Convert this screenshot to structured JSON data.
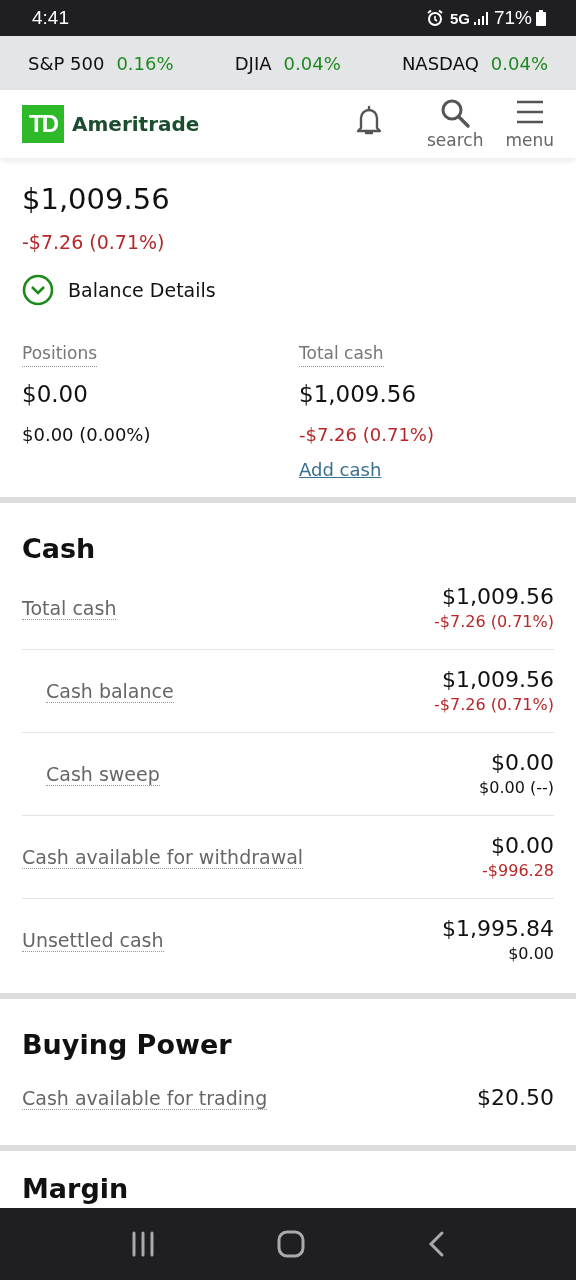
{
  "status_bar": {
    "time": "4:41",
    "network": "5G",
    "battery": "71%"
  },
  "tickers": [
    {
      "name": "S&P 500",
      "change": "0.16%",
      "color": "#1f8a1f"
    },
    {
      "name": "DJIA",
      "change": "0.04%",
      "color": "#1f8a1f"
    },
    {
      "name": "NASDAQ",
      "change": "0.04%",
      "color": "#1f8a1f"
    }
  ],
  "header": {
    "logo_mark": "TD",
    "logo_text": "Ameritrade",
    "actions": [
      {
        "kind": "bell"
      },
      {
        "kind": "search",
        "label": "search"
      },
      {
        "kind": "menu",
        "label": "menu"
      }
    ]
  },
  "summary": {
    "total": "$1,009.56",
    "change": "-$7.26 (0.71%)",
    "negative": true,
    "details_toggle": {
      "label": "Balance Details",
      "expanded": false
    },
    "columns": [
      {
        "label": "Positions",
        "value": "$0.00",
        "change": "$0.00 (0.00%)",
        "negative": false
      },
      {
        "label": "Total cash",
        "value": "$1,009.56",
        "change": "-$7.26 (0.71%)",
        "negative": true,
        "link": "Add cash"
      }
    ]
  },
  "sections": [
    {
      "title": "Cash",
      "rows": [
        {
          "label": "Total cash",
          "value": "$1,009.56",
          "change": "-$7.26 (0.71%)",
          "negative": true,
          "children": [
            {
              "label": "Cash balance",
              "value": "$1,009.56",
              "change": "-$7.26 (0.71%)",
              "negative": true
            },
            {
              "label": "Cash sweep",
              "value": "$0.00",
              "change": "$0.00 (--)",
              "negative": false
            }
          ]
        },
        {
          "label": "Cash available for withdrawal",
          "value": "$0.00",
          "change": "-$996.28",
          "negative": true
        },
        {
          "label": "Unsettled cash",
          "value": "$1,995.84",
          "change": "$0.00",
          "negative": false
        }
      ]
    },
    {
      "title": "Buying Power",
      "rows": [
        {
          "label": "Cash available for trading",
          "value": "$20.50"
        }
      ]
    },
    {
      "title": "Margin"
    }
  ]
}
